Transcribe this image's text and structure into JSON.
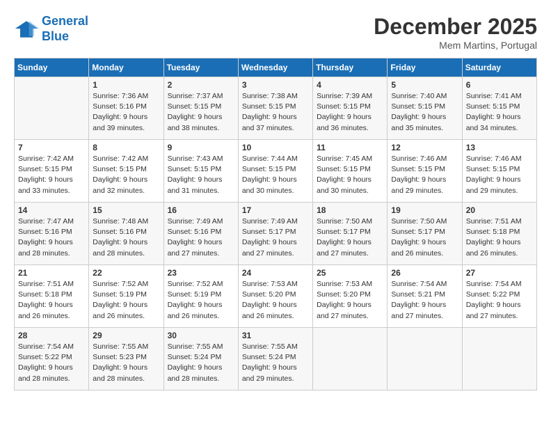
{
  "header": {
    "logo_line1": "General",
    "logo_line2": "Blue",
    "month": "December 2025",
    "location": "Mem Martins, Portugal"
  },
  "days_of_week": [
    "Sunday",
    "Monday",
    "Tuesday",
    "Wednesday",
    "Thursday",
    "Friday",
    "Saturday"
  ],
  "weeks": [
    [
      {
        "day": "",
        "info": ""
      },
      {
        "day": "1",
        "info": "Sunrise: 7:36 AM\nSunset: 5:16 PM\nDaylight: 9 hours\nand 39 minutes."
      },
      {
        "day": "2",
        "info": "Sunrise: 7:37 AM\nSunset: 5:15 PM\nDaylight: 9 hours\nand 38 minutes."
      },
      {
        "day": "3",
        "info": "Sunrise: 7:38 AM\nSunset: 5:15 PM\nDaylight: 9 hours\nand 37 minutes."
      },
      {
        "day": "4",
        "info": "Sunrise: 7:39 AM\nSunset: 5:15 PM\nDaylight: 9 hours\nand 36 minutes."
      },
      {
        "day": "5",
        "info": "Sunrise: 7:40 AM\nSunset: 5:15 PM\nDaylight: 9 hours\nand 35 minutes."
      },
      {
        "day": "6",
        "info": "Sunrise: 7:41 AM\nSunset: 5:15 PM\nDaylight: 9 hours\nand 34 minutes."
      }
    ],
    [
      {
        "day": "7",
        "info": "Sunrise: 7:42 AM\nSunset: 5:15 PM\nDaylight: 9 hours\nand 33 minutes."
      },
      {
        "day": "8",
        "info": "Sunrise: 7:42 AM\nSunset: 5:15 PM\nDaylight: 9 hours\nand 32 minutes."
      },
      {
        "day": "9",
        "info": "Sunrise: 7:43 AM\nSunset: 5:15 PM\nDaylight: 9 hours\nand 31 minutes."
      },
      {
        "day": "10",
        "info": "Sunrise: 7:44 AM\nSunset: 5:15 PM\nDaylight: 9 hours\nand 30 minutes."
      },
      {
        "day": "11",
        "info": "Sunrise: 7:45 AM\nSunset: 5:15 PM\nDaylight: 9 hours\nand 30 minutes."
      },
      {
        "day": "12",
        "info": "Sunrise: 7:46 AM\nSunset: 5:15 PM\nDaylight: 9 hours\nand 29 minutes."
      },
      {
        "day": "13",
        "info": "Sunrise: 7:46 AM\nSunset: 5:15 PM\nDaylight: 9 hours\nand 29 minutes."
      }
    ],
    [
      {
        "day": "14",
        "info": "Sunrise: 7:47 AM\nSunset: 5:16 PM\nDaylight: 9 hours\nand 28 minutes."
      },
      {
        "day": "15",
        "info": "Sunrise: 7:48 AM\nSunset: 5:16 PM\nDaylight: 9 hours\nand 28 minutes."
      },
      {
        "day": "16",
        "info": "Sunrise: 7:49 AM\nSunset: 5:16 PM\nDaylight: 9 hours\nand 27 minutes."
      },
      {
        "day": "17",
        "info": "Sunrise: 7:49 AM\nSunset: 5:17 PM\nDaylight: 9 hours\nand 27 minutes."
      },
      {
        "day": "18",
        "info": "Sunrise: 7:50 AM\nSunset: 5:17 PM\nDaylight: 9 hours\nand 27 minutes."
      },
      {
        "day": "19",
        "info": "Sunrise: 7:50 AM\nSunset: 5:17 PM\nDaylight: 9 hours\nand 26 minutes."
      },
      {
        "day": "20",
        "info": "Sunrise: 7:51 AM\nSunset: 5:18 PM\nDaylight: 9 hours\nand 26 minutes."
      }
    ],
    [
      {
        "day": "21",
        "info": "Sunrise: 7:51 AM\nSunset: 5:18 PM\nDaylight: 9 hours\nand 26 minutes."
      },
      {
        "day": "22",
        "info": "Sunrise: 7:52 AM\nSunset: 5:19 PM\nDaylight: 9 hours\nand 26 minutes."
      },
      {
        "day": "23",
        "info": "Sunrise: 7:52 AM\nSunset: 5:19 PM\nDaylight: 9 hours\nand 26 minutes."
      },
      {
        "day": "24",
        "info": "Sunrise: 7:53 AM\nSunset: 5:20 PM\nDaylight: 9 hours\nand 26 minutes."
      },
      {
        "day": "25",
        "info": "Sunrise: 7:53 AM\nSunset: 5:20 PM\nDaylight: 9 hours\nand 27 minutes."
      },
      {
        "day": "26",
        "info": "Sunrise: 7:54 AM\nSunset: 5:21 PM\nDaylight: 9 hours\nand 27 minutes."
      },
      {
        "day": "27",
        "info": "Sunrise: 7:54 AM\nSunset: 5:22 PM\nDaylight: 9 hours\nand 27 minutes."
      }
    ],
    [
      {
        "day": "28",
        "info": "Sunrise: 7:54 AM\nSunset: 5:22 PM\nDaylight: 9 hours\nand 28 minutes."
      },
      {
        "day": "29",
        "info": "Sunrise: 7:55 AM\nSunset: 5:23 PM\nDaylight: 9 hours\nand 28 minutes."
      },
      {
        "day": "30",
        "info": "Sunrise: 7:55 AM\nSunset: 5:24 PM\nDaylight: 9 hours\nand 28 minutes."
      },
      {
        "day": "31",
        "info": "Sunrise: 7:55 AM\nSunset: 5:24 PM\nDaylight: 9 hours\nand 29 minutes."
      },
      {
        "day": "",
        "info": ""
      },
      {
        "day": "",
        "info": ""
      },
      {
        "day": "",
        "info": ""
      }
    ]
  ]
}
